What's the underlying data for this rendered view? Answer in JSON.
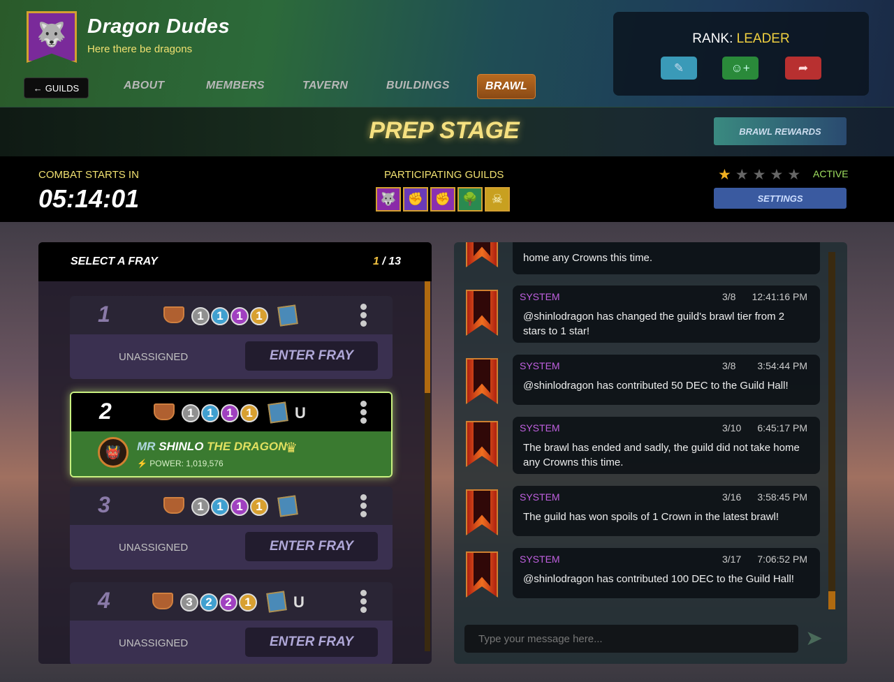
{
  "guild": {
    "name": "Dragon Dudes",
    "motto": "Here there be dragons",
    "banner_icon": "wolf-banner-icon"
  },
  "nav": {
    "back_label": "GUILDS",
    "tabs": [
      {
        "label": "ABOUT"
      },
      {
        "label": "MEMBERS"
      },
      {
        "label": "TAVERN"
      },
      {
        "label": "BUILDINGS"
      },
      {
        "label": "BRAWL",
        "active": true
      }
    ]
  },
  "rank": {
    "label": "RANK:",
    "value": "LEADER"
  },
  "stage": {
    "title": "PREP STAGE",
    "rewards_label": "BRAWL REWARDS",
    "combat_label": "COMBAT STARTS IN",
    "timer": "05:14:01",
    "participating_label": "PARTICIPATING GUILDS",
    "guilds": [
      {
        "icon": "wolf",
        "color": "#8a2aa8"
      },
      {
        "icon": "fist",
        "color": "#6a3ab8"
      },
      {
        "icon": "fist",
        "color": "#8a30b0"
      },
      {
        "icon": "tree",
        "color": "#2a8a50"
      },
      {
        "icon": "skull",
        "color": "#c8a020"
      }
    ],
    "stars_filled": 1,
    "stars_total": 5,
    "status": "ACTIVE",
    "settings_label": "SETTINGS"
  },
  "fray": {
    "title": "SELECT A FRAY",
    "page_current": "1",
    "page_sep": " / ",
    "page_total": "13",
    "unassigned_label": "UNASSIGNED",
    "enter_label": "ENTER FRAY",
    "items": [
      {
        "num": "1",
        "dots": [
          "1",
          "1",
          "1",
          "1"
        ]
      },
      {
        "num": "2",
        "dots": [
          "1",
          "1",
          "1",
          "1"
        ],
        "u": "U",
        "player": {
          "name_a": "MR",
          "name_b": "SHINLO",
          "name_c": "THE DRAGON",
          "power_label": "POWER: 1,019,576"
        }
      },
      {
        "num": "3",
        "dots": [
          "1",
          "1",
          "1",
          "1"
        ]
      },
      {
        "num": "4",
        "dots": [
          "3",
          "2",
          "2",
          "1"
        ],
        "u": "U"
      }
    ]
  },
  "chat": {
    "messages": [
      {
        "sender": "",
        "date": "",
        "time": "",
        "text": "home any Crowns this time."
      },
      {
        "sender": "SYSTEM",
        "date": "3/8",
        "time": "12:41:16 PM",
        "text": "@shinlodragon has changed the guild's brawl tier from 2 stars to 1 star!"
      },
      {
        "sender": "SYSTEM",
        "date": "3/8",
        "time": "3:54:44 PM",
        "text": "@shinlodragon has contributed 50 DEC to the Guild Hall!"
      },
      {
        "sender": "SYSTEM",
        "date": "3/10",
        "time": "6:45:17 PM",
        "text": "The brawl has ended and sadly, the guild did not take home any Crowns this time."
      },
      {
        "sender": "SYSTEM",
        "date": "3/16",
        "time": "3:58:45 PM",
        "text": "The guild has won spoils of 1 Crown in the latest brawl!"
      },
      {
        "sender": "SYSTEM",
        "date": "3/17",
        "time": "7:06:52 PM",
        "text": "@shinlodragon has contributed 100 DEC to the Guild Hall!"
      }
    ],
    "placeholder": "Type your message here..."
  }
}
